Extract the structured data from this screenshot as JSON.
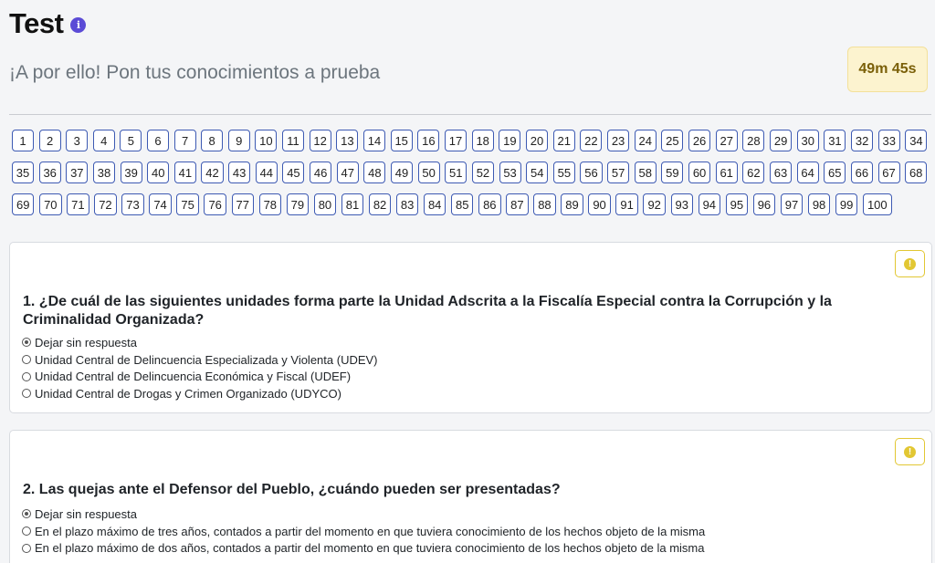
{
  "header": {
    "title": "Test",
    "info_icon": "i",
    "subtitle": "¡A por ello! Pon tus conocimientos a prueba",
    "timer": "49m 45s"
  },
  "nav": {
    "rows": [
      [
        "1",
        "2",
        "3",
        "4",
        "5",
        "6",
        "7",
        "8",
        "9",
        "10",
        "11",
        "12",
        "13",
        "14",
        "15",
        "16",
        "17",
        "18",
        "19",
        "20",
        "21",
        "22",
        "23",
        "24",
        "25",
        "26",
        "27",
        "28",
        "29",
        "30",
        "31",
        "32",
        "33",
        "34"
      ],
      [
        "35",
        "36",
        "37",
        "38",
        "39",
        "40",
        "41",
        "42",
        "43",
        "44",
        "45",
        "46",
        "47",
        "48",
        "49",
        "50",
        "51",
        "52",
        "53",
        "54",
        "55",
        "56",
        "57",
        "58",
        "59",
        "60",
        "61",
        "62",
        "63",
        "64",
        "65",
        "66",
        "67",
        "68"
      ],
      [
        "69",
        "70",
        "71",
        "72",
        "73",
        "74",
        "75",
        "76",
        "77",
        "78",
        "79",
        "80",
        "81",
        "82",
        "83",
        "84",
        "85",
        "86",
        "87",
        "88",
        "89",
        "90",
        "91",
        "92",
        "93",
        "94",
        "95",
        "96",
        "97",
        "98",
        "99",
        "100"
      ]
    ]
  },
  "questions": [
    {
      "text": "1. ¿De cuál de las siguientes unidades forma parte la Unidad Adscrita a la Fiscalía Especial contra la Corrupción y la Criminalidad Organizada?",
      "options": [
        "Dejar sin respuesta",
        "Unidad Central de Delincuencia Especializada y Violenta (UDEV)",
        "Unidad Central de Delincuencia Económica y Fiscal (UDEF)",
        "Unidad Central de Drogas y Crimen Organizado (UDYCO)"
      ]
    },
    {
      "text": "2. Las quejas ante el Defensor del Pueblo, ¿cuándo pueden ser presentadas?",
      "options": [
        "Dejar sin respuesta",
        "En el plazo máximo de tres años, contados a partir del momento en que tuviera conocimiento de los hechos objeto de la misma",
        "En el plazo máximo de dos años, contados a partir del momento en que tuviera conocimiento de los hechos objeto de la misma"
      ]
    }
  ],
  "flag_icon": "!",
  "colors": {
    "accent": "#3d5ab3",
    "flag": "#e2c733",
    "timer_bg": "#fcf3cf"
  }
}
